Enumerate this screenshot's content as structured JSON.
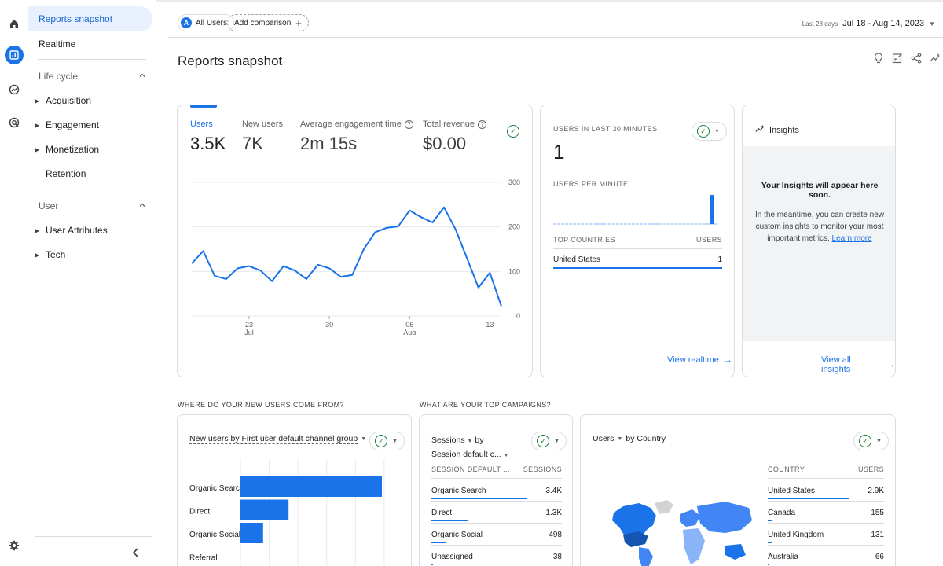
{
  "sidebar": {
    "items": [
      {
        "label": "Reports snapshot"
      },
      {
        "label": "Realtime"
      }
    ],
    "sections": [
      {
        "label": "Life cycle",
        "items": [
          "Acquisition",
          "Engagement",
          "Monetization",
          "Retention"
        ]
      },
      {
        "label": "User",
        "items": [
          "User Attributes",
          "Tech"
        ]
      }
    ]
  },
  "header": {
    "segment_badge": "A",
    "segment": "All Users",
    "add_comparison": "Add comparison",
    "date_label": "Last 28 days",
    "date_range": "Jul 18 - Aug 14, 2023"
  },
  "page": {
    "title": "Reports snapshot"
  },
  "metrics": [
    {
      "label": "Users",
      "value": "3.5K"
    },
    {
      "label": "New users",
      "value": "7K"
    },
    {
      "label": "Average engagement time",
      "value": "2m 15s"
    },
    {
      "label": "Total revenue",
      "value": "$0.00"
    }
  ],
  "chart_data": {
    "type": "line",
    "x_ticks": [
      {
        "day": "23",
        "month": "Jul"
      },
      {
        "day": "30",
        "month": ""
      },
      {
        "day": "06",
        "month": "Aug"
      },
      {
        "day": "13",
        "month": ""
      }
    ],
    "y_ticks": [
      "300",
      "200",
      "100",
      "0"
    ],
    "ylim": [
      0,
      300
    ],
    "series": [
      {
        "values": [
          118,
          146,
          90,
          83,
          107,
          112,
          102,
          78,
          112,
          102,
          83,
          115,
          107,
          88,
          92,
          150,
          188,
          198,
          201,
          237,
          222,
          210,
          244,
          195,
          130,
          64,
          97,
          22
        ]
      }
    ],
    "color": "#1a73e8"
  },
  "realtime": {
    "title": "USERS IN LAST 30 MINUTES",
    "value": "1",
    "per_minute": "USERS PER MINUTE",
    "countries_header": "TOP COUNTRIES",
    "users_header": "USERS",
    "rows": [
      {
        "country": "United States",
        "users": "1"
      }
    ],
    "link": "View realtime"
  },
  "insights": {
    "title": "Insights",
    "headline": "Your Insights will appear here soon.",
    "body": "In the meantime, you can create new custom insights to monitor your most important metrics.",
    "learn_more": "Learn more",
    "link": "View all insights"
  },
  "new_users": {
    "question": "WHERE DO YOUR NEW USERS COME FROM?",
    "title": "New users by First user default channel group",
    "bars": [
      {
        "label": "Organic Search",
        "value": 100
      },
      {
        "label": "Direct",
        "value": 34
      },
      {
        "label": "Organic Social",
        "value": 16
      },
      {
        "label": "Referral",
        "value": 0
      }
    ]
  },
  "campaigns": {
    "question": "WHAT ARE YOUR TOP CAMPAIGNS?",
    "title_line1": "Sessions",
    "title_by": "by",
    "title_line2": "Session default c...",
    "col1": "SESSION DEFAULT ...",
    "col2": "SESSIONS",
    "rows": [
      {
        "name": "Organic Search",
        "value": "3.4K",
        "share": 1.0
      },
      {
        "name": "Direct",
        "value": "1.3K",
        "share": 0.38
      },
      {
        "name": "Organic Social",
        "value": "498",
        "share": 0.15
      },
      {
        "name": "Unassigned",
        "value": "38",
        "share": 0.02
      }
    ]
  },
  "country": {
    "title_metric": "Users",
    "title_rest": "by Country",
    "col1": "COUNTRY",
    "col2": "USERS",
    "rows": [
      {
        "name": "United States",
        "value": "2.9K",
        "share": 1.0
      },
      {
        "name": "Canada",
        "value": "155",
        "share": 0.05
      },
      {
        "name": "United Kingdom",
        "value": "131",
        "share": 0.045
      },
      {
        "name": "Australia",
        "value": "66",
        "share": 0.023
      }
    ]
  }
}
